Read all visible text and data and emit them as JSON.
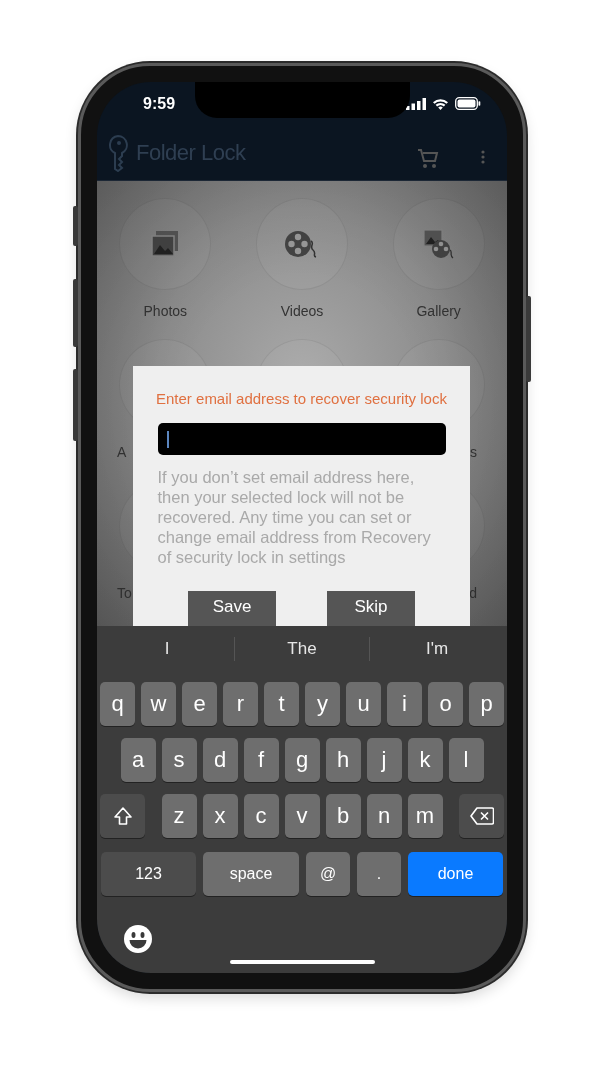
{
  "status_bar": {
    "time": "9:59"
  },
  "app_bar": {
    "title": "Folder Lock"
  },
  "grid": {
    "items": [
      {
        "kind": "photos",
        "label": "Photos"
      },
      {
        "kind": "videos",
        "label": "Videos"
      },
      {
        "kind": "gallery",
        "label": "Gallery"
      }
    ],
    "partial_rows": [
      {
        "left_label": "A",
        "right_label": "s"
      },
      {
        "left_label": "To",
        "right_label": "d"
      }
    ]
  },
  "dialog": {
    "title": "Enter email address to recover security lock",
    "body": "If you don’t set email address here, then your selected lock will not be recovered. Any time you can set or change email address from Recovery of security lock in settings",
    "buttons": [
      "Save",
      "Skip"
    ]
  },
  "keyboard": {
    "suggestions": [
      "I",
      "The",
      "I'm"
    ],
    "rows": [
      [
        "q",
        "w",
        "e",
        "r",
        "t",
        "y",
        "u",
        "i",
        "o",
        "p"
      ],
      [
        "a",
        "s",
        "d",
        "f",
        "g",
        "h",
        "j",
        "k",
        "l"
      ],
      [
        "z",
        "x",
        "c",
        "v",
        "b",
        "n",
        "m"
      ]
    ],
    "bottom": [
      {
        "kind": "mode",
        "label": "123"
      },
      {
        "kind": "space",
        "label": "space"
      },
      {
        "kind": "char",
        "label": "@"
      },
      {
        "kind": "char",
        "label": "."
      },
      {
        "kind": "action",
        "label": "done"
      }
    ]
  }
}
